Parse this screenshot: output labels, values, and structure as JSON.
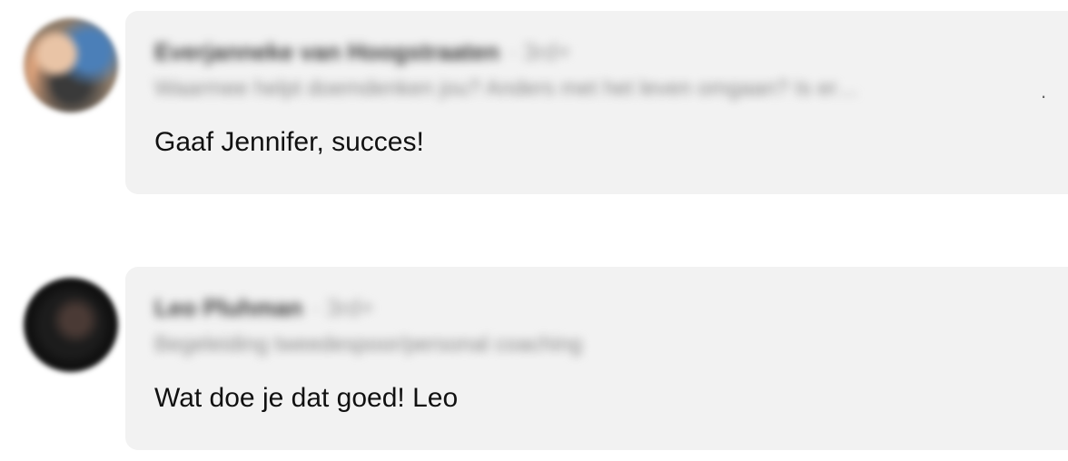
{
  "comments": [
    {
      "author": "Everjanneke van Hoogstraaten",
      "time": "· 3rd+",
      "headline": "Waarmee helpt doemdenken jou? Anders met het leven omgaan? Is er…",
      "headline_more": ".",
      "text": "Gaaf Jennifer, succes!"
    },
    {
      "author": "Leo Pluhman",
      "time": "· 3rd+",
      "headline": "Begeleiding tweedespoor/personal coaching",
      "text": "Wat doe je dat goed! Leo"
    }
  ]
}
